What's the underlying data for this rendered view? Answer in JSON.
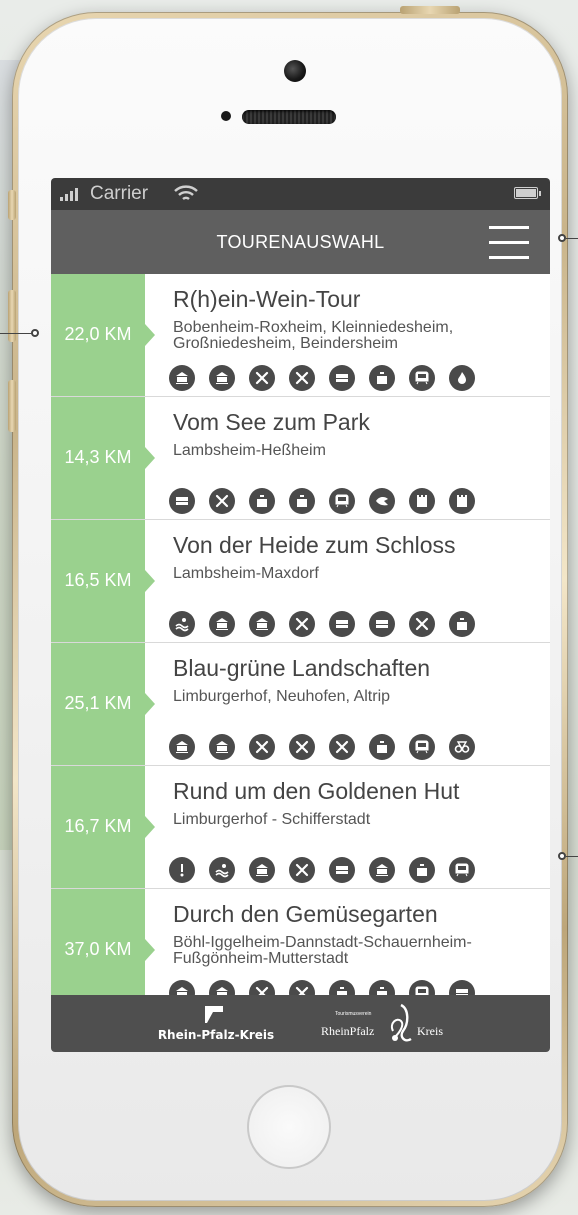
{
  "statusbar": {
    "carrier": "Carrier"
  },
  "navbar": {
    "title": "TOURENAUSWAHL"
  },
  "tours": [
    {
      "km": "22,0 KM",
      "title": "R(h)ein-Wein-Tour",
      "places": "Bobenheim-Roxheim, Kleinniedesheim, Großniedesheim, Beindersheim",
      "icons": [
        "museum-icon",
        "museum-icon",
        "restaurant-icon",
        "restaurant-icon",
        "bed-icon",
        "shop-icon",
        "train-icon",
        "fire-icon"
      ]
    },
    {
      "km": "14,3 KM",
      "title": "Vom See zum Park",
      "places": "Lambsheim-Heßheim",
      "icons": [
        "bed-icon",
        "restaurant-icon",
        "shop-icon",
        "shop-icon",
        "train-icon",
        "bird-icon",
        "tower-icon",
        "tower-icon"
      ]
    },
    {
      "km": "16,5 KM",
      "title": "Von der Heide zum Schloss",
      "places": "Lambsheim-Maxdorf",
      "icons": [
        "swim-icon",
        "museum-icon",
        "museum-icon",
        "restaurant-icon",
        "bed-icon",
        "bed-icon",
        "restaurant-icon",
        "shop-icon"
      ]
    },
    {
      "km": "25,1 KM",
      "title": "Blau-grüne Landschaften",
      "places": "Limburgerhof, Neuhofen, Altrip",
      "icons": [
        "museum-icon",
        "museum-icon",
        "restaurant-icon",
        "restaurant-icon",
        "restaurant-icon",
        "shop-icon",
        "train-icon",
        "bike-icon"
      ]
    },
    {
      "km": "16,7 KM",
      "title": "Rund um den Goldenen Hut",
      "places": "Limburgerhof - Schifferstadt",
      "icons": [
        "info-icon",
        "swim-icon",
        "museum-icon",
        "restaurant-icon",
        "bed-icon",
        "museum-icon",
        "shop-icon",
        "train-icon"
      ]
    },
    {
      "km": "37,0 KM",
      "title": "Durch den Gemüsegarten",
      "places": "Böhl-Iggelheim-Dannstadt-Schauernheim-Fußgönheim-Mutterstadt",
      "icons": [
        "museum-icon",
        "museum-icon",
        "restaurant-icon",
        "restaurant-icon",
        "shop-icon",
        "shop-icon",
        "train-icon",
        "bed-icon"
      ]
    }
  ],
  "footer": {
    "logo1_text": "Rhein-Pfalz-Kreis",
    "logo2_small": "Tourismusverein",
    "logo2_text": "RheinPfalz",
    "logo2_kreis": "Kreis"
  },
  "colors": {
    "accent": "#9ad18e",
    "navbar": "#5f5f5f",
    "statusbar": "#3b3b3b",
    "footer": "#4f4f4f",
    "icon": "#4a4a4a"
  }
}
